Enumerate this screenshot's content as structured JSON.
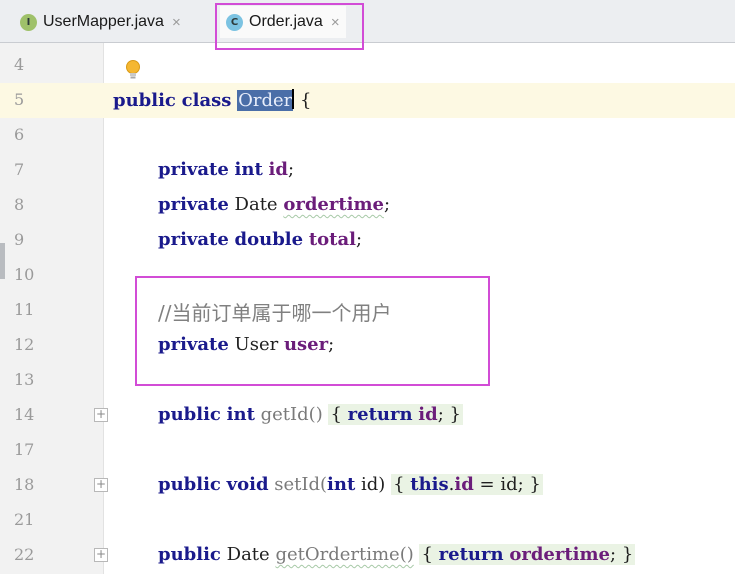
{
  "tabs": [
    {
      "label": "UserMapper.java",
      "icon": "interface-file-icon",
      "icon_letter": "I",
      "close": "×"
    },
    {
      "label": "Order.java",
      "icon": "class-file-icon",
      "icon_letter": "C",
      "close": "×"
    }
  ],
  "line_numbers": {
    "l4": "4",
    "l5": "5",
    "l6": "6",
    "l7": "7",
    "l8": "8",
    "l9": "9",
    "l10": "10",
    "l11": "11",
    "l12": "12",
    "l13": "13",
    "l14": "14",
    "l17": "17",
    "l18": "18",
    "l21": "21",
    "l22": "22"
  },
  "code": {
    "public": "public",
    "class": "class",
    "private": "private",
    "int": "int",
    "double": "double",
    "void": "void",
    "return": "return",
    "this": "this",
    "class_name": "Order",
    "open_brace": "{",
    "close_brace": "}",
    "semicolon": ";",
    "id": "id",
    "Date": "Date",
    "ordertime": "ordertime",
    "total": "total",
    "comment": "//当前订单属于哪一个用户",
    "User": "User",
    "user": "user",
    "getId": "getId()",
    "setId": "setId(",
    "param_close": " id)",
    "assign": " = id",
    "getOrdertime": "getOrdertime()",
    "this_dot": "."
  },
  "colors": {
    "keyword": "#1a1a8c",
    "field": "#6b1d7a",
    "highlight_box": "#d24cd6",
    "selection": "#4a6ea8"
  }
}
